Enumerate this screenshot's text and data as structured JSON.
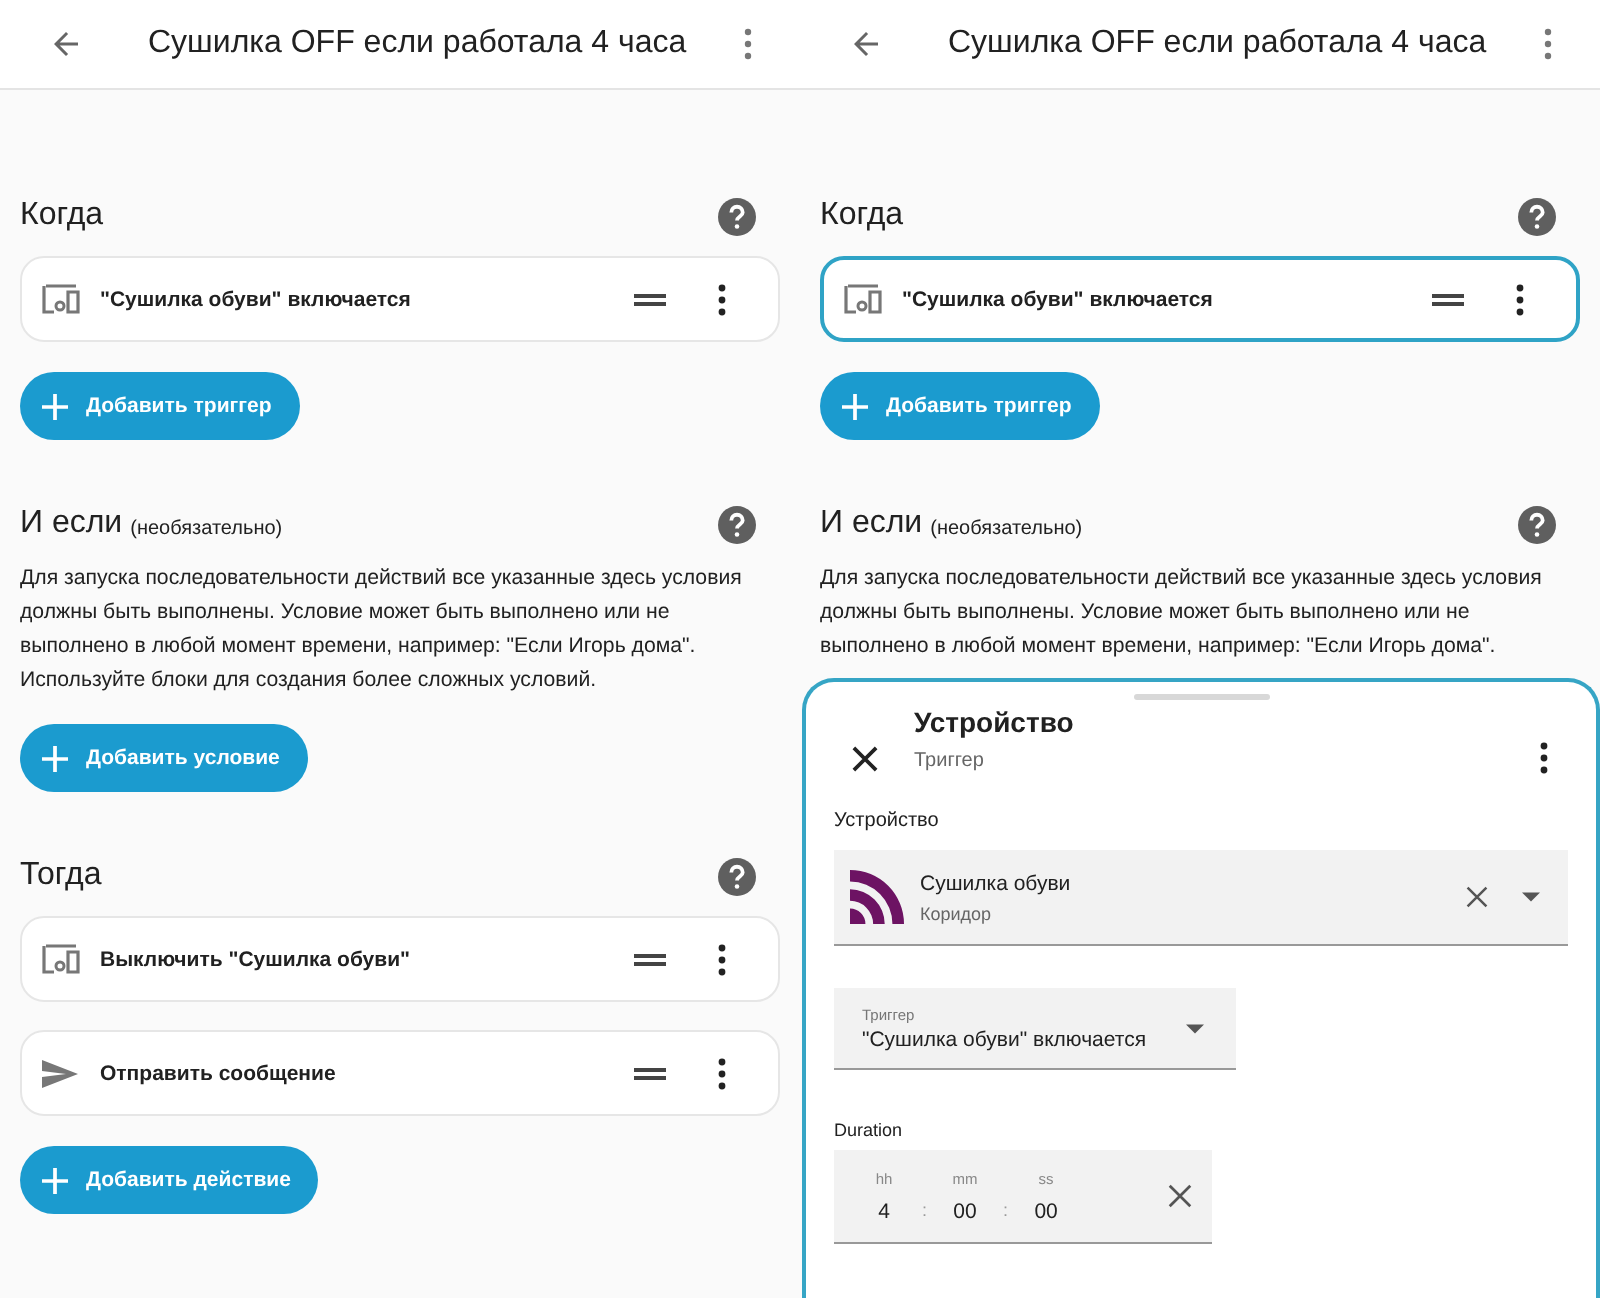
{
  "screens": [
    {
      "header": {
        "title": "Сушилка OFF если работала 4 часа"
      },
      "sections": [
        {
          "title": "Когда",
          "items": [
            {
              "kind": "device",
              "label": "\"Сушилка обуви\" включается",
              "selected": false
            }
          ],
          "add_button": "Добавить триггер"
        },
        {
          "title": "И если",
          "hint": "(необязательно)",
          "description": [
            "Для запуска последовательности действий все указанные здесь условия",
            "должны быть выполнены. Условие может быть выполнено или не",
            "выполнено в любой момент времени, например: \"Если Игорь дома\".",
            "Используйте блоки для создания более сложных условий."
          ],
          "add_button": "Добавить условие"
        },
        {
          "title": "Тогда",
          "items": [
            {
              "kind": "device",
              "label": "Выключить \"Сушилка обуви\"",
              "selected": false
            },
            {
              "kind": "message",
              "label": "Отправить сообщение",
              "selected": false
            }
          ],
          "add_button": "Добавить действие"
        }
      ]
    },
    {
      "header": {
        "title": "Сушилка OFF если работала 4 часа"
      },
      "sections": [
        {
          "title": "Когда",
          "items": [
            {
              "kind": "device",
              "label": "\"Сушилка обуви\" включается",
              "selected": true
            }
          ],
          "add_button": "Добавить триггер"
        },
        {
          "title": "И если",
          "hint": "(необязательно)",
          "description": [
            "Для запуска последовательности действий все указанные здесь условия",
            "должны быть выполнены. Условие может быть выполнено или не",
            "выполнено в любой момент времени, например: \"Если Игорь дома\"."
          ]
        }
      ],
      "sheet": {
        "title": "Устройство",
        "subtitle": "Триггер",
        "device_label": "Устройство",
        "device": {
          "name": "Сушилка обуви",
          "area": "Коридор"
        },
        "trigger": {
          "label": "Триггер",
          "value": "\"Сушилка обуви\" включается"
        },
        "duration": {
          "label": "Duration",
          "separator": ":",
          "fields": [
            {
              "label": "hh",
              "value": "4"
            },
            {
              "label": "mm",
              "value": "00"
            },
            {
              "label": "ss",
              "value": "00"
            }
          ]
        }
      }
    }
  ]
}
